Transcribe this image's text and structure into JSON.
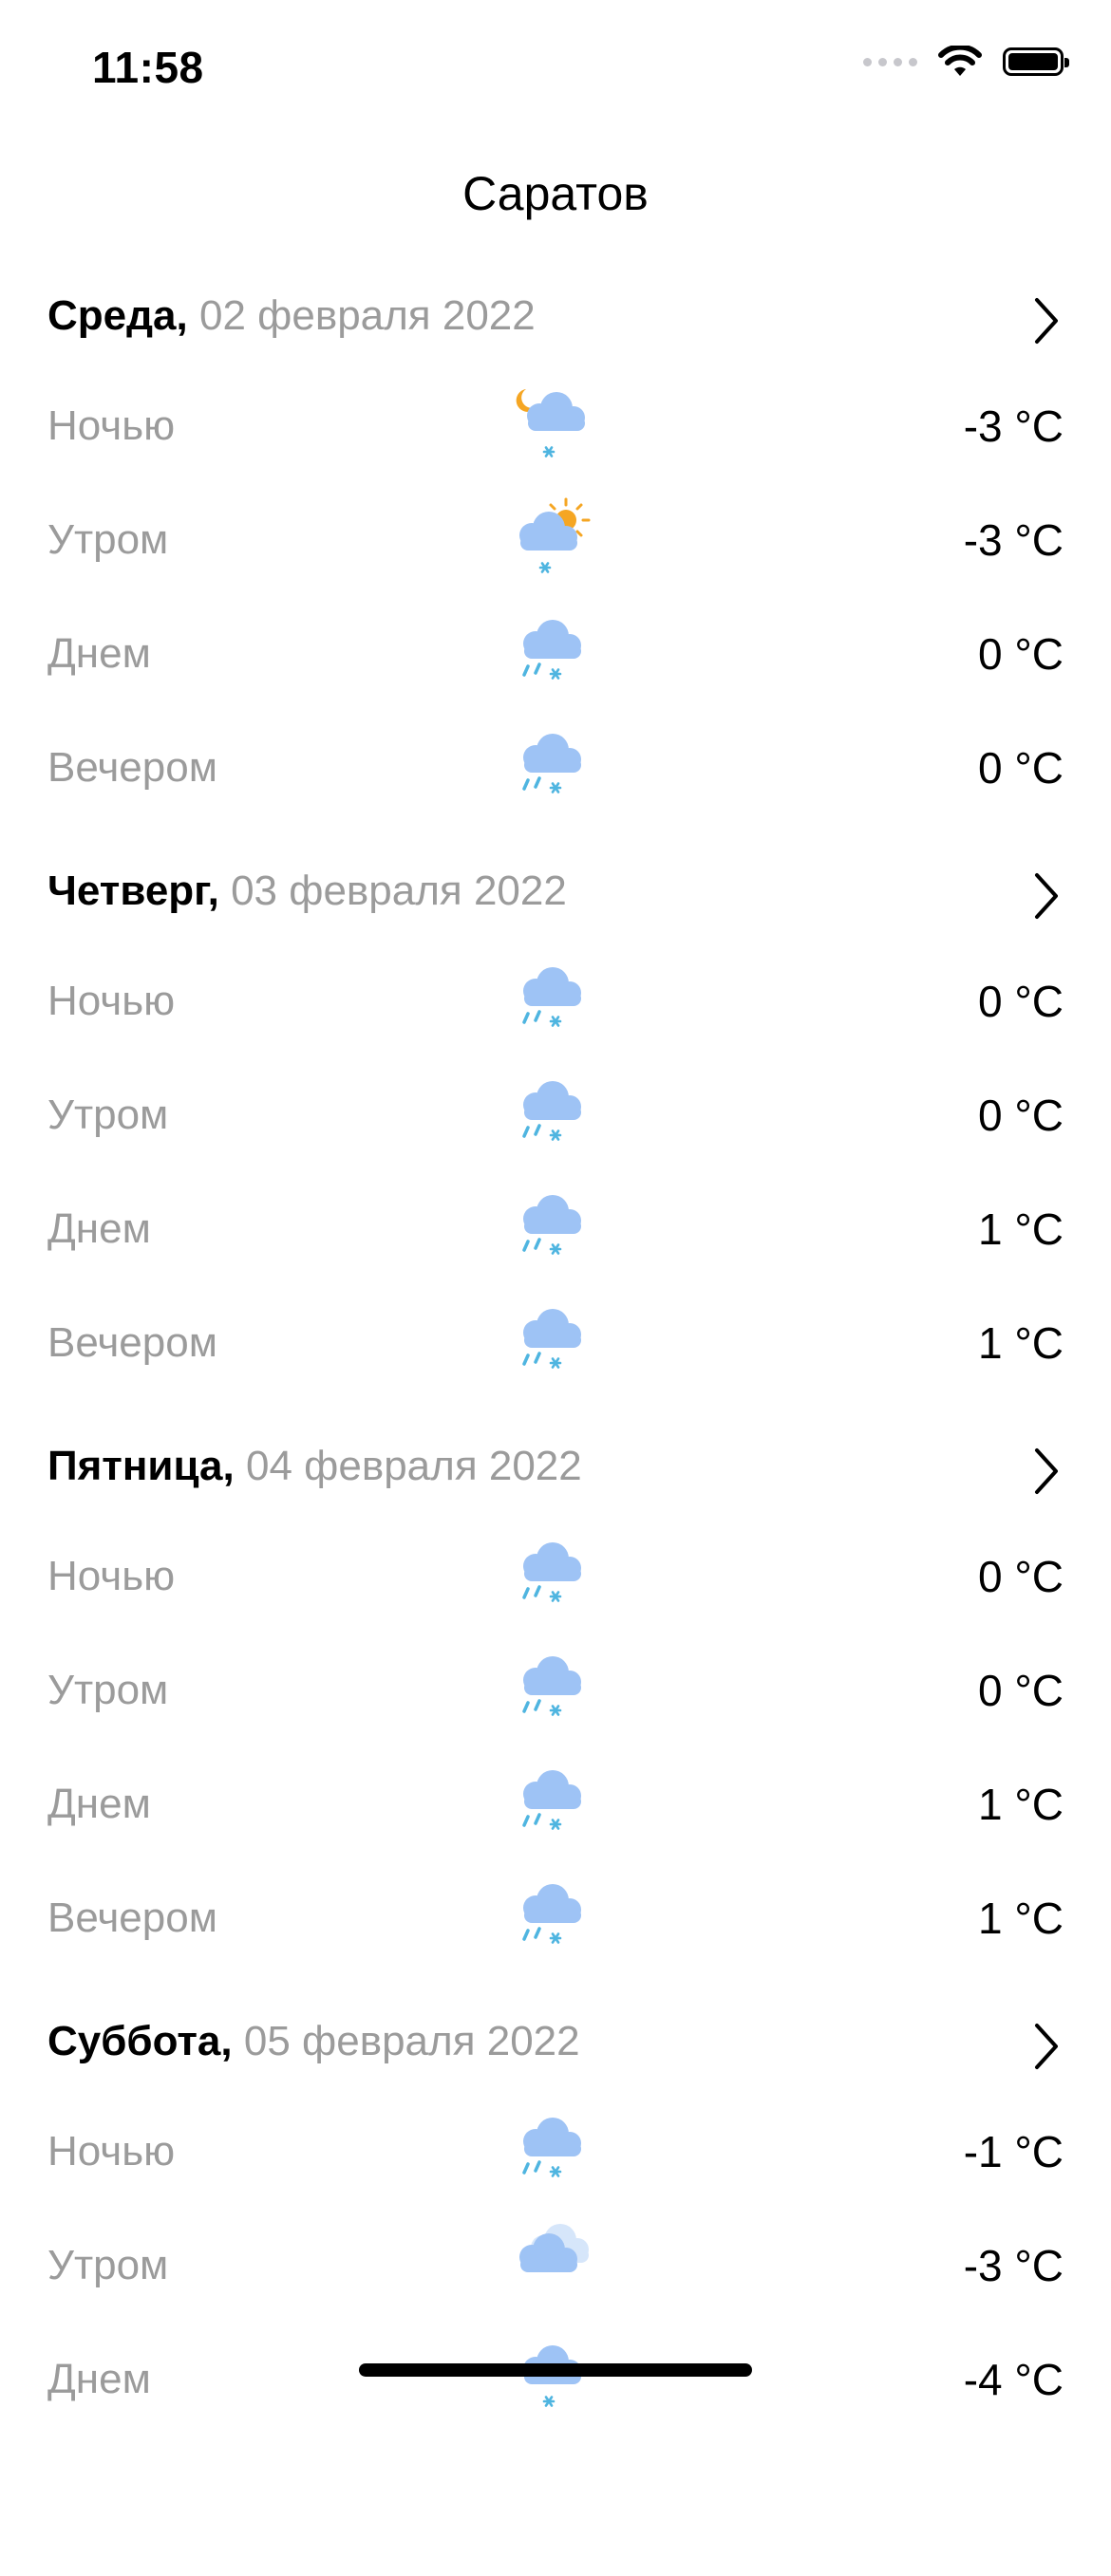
{
  "status_bar": {
    "time": "11:58"
  },
  "nav": {
    "title": "Саратов"
  },
  "days": [
    {
      "name": "Среда,",
      "date": " 02 февраля 2022",
      "periods": [
        {
          "label": "Ночью",
          "icon": "night-cloud-snow-icon",
          "temp": "-3 °C"
        },
        {
          "label": "Утром",
          "icon": "sun-cloud-snow-icon",
          "temp": "-3 °C"
        },
        {
          "label": "Днем",
          "icon": "cloud-rain-snow-icon",
          "temp": "0 °C"
        },
        {
          "label": "Вечером",
          "icon": "cloud-rain-snow-icon",
          "temp": "0 °C"
        }
      ]
    },
    {
      "name": "Четверг,",
      "date": " 03 февраля 2022",
      "periods": [
        {
          "label": "Ночью",
          "icon": "cloud-rain-snow-icon",
          "temp": "0 °C"
        },
        {
          "label": "Утром",
          "icon": "cloud-rain-snow-icon",
          "temp": "0 °C"
        },
        {
          "label": "Днем",
          "icon": "cloud-rain-snow-icon",
          "temp": "1 °C"
        },
        {
          "label": "Вечером",
          "icon": "cloud-rain-snow-icon",
          "temp": "1 °C"
        }
      ]
    },
    {
      "name": "Пятница,",
      "date": " 04 февраля 2022",
      "periods": [
        {
          "label": "Ночью",
          "icon": "cloud-rain-snow-icon",
          "temp": "0 °C"
        },
        {
          "label": "Утром",
          "icon": "cloud-rain-snow-icon",
          "temp": "0 °C"
        },
        {
          "label": "Днем",
          "icon": "cloud-rain-snow-icon",
          "temp": "1 °C"
        },
        {
          "label": "Вечером",
          "icon": "cloud-rain-snow-icon",
          "temp": "1 °C"
        }
      ]
    },
    {
      "name": "Суббота,",
      "date": " 05 февраля 2022",
      "periods": [
        {
          "label": "Ночью",
          "icon": "cloud-rain-snow-icon",
          "temp": "-1 °C"
        },
        {
          "label": "Утром",
          "icon": "overcast-icon",
          "temp": "-3 °C"
        },
        {
          "label": "Днем",
          "icon": "cloud-snow-icon",
          "temp": "-4 °C"
        }
      ]
    }
  ],
  "colors": {
    "cloud": "#9ec3f5",
    "snow": "#4fb5e0",
    "sun": "#f5a623",
    "secondary_text": "#9b9b9b"
  }
}
